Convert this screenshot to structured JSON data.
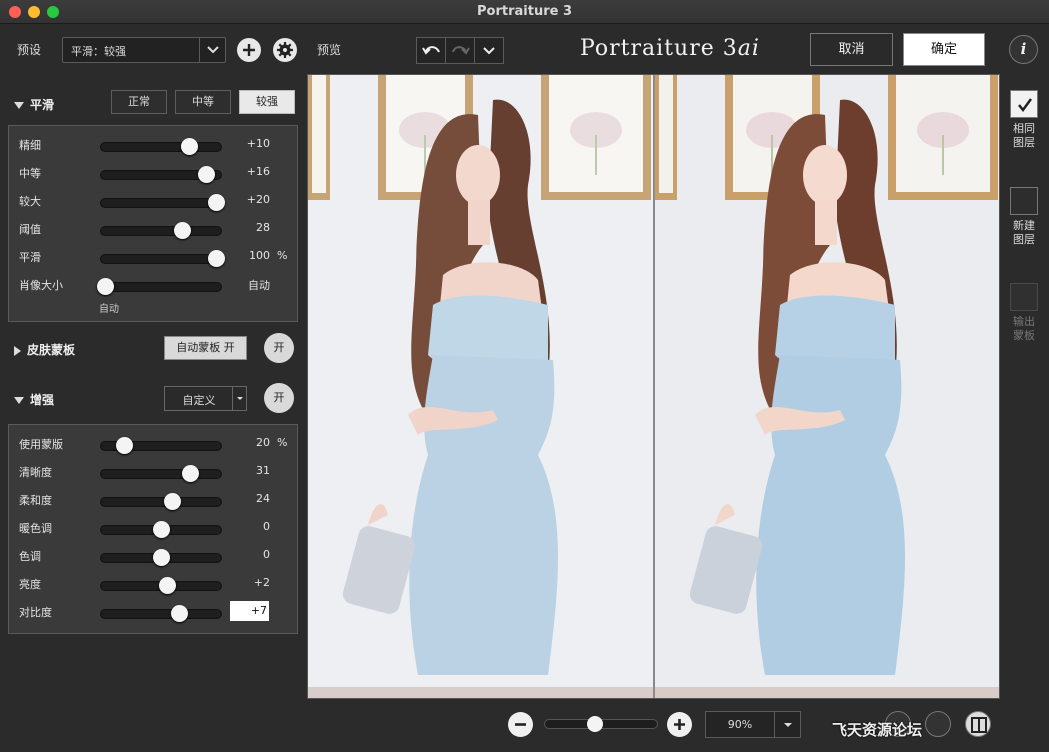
{
  "window": {
    "title": "Portraiture 3"
  },
  "toolbar": {
    "preset_label": "预设",
    "preset_value": "平滑：较强",
    "preview_label": "预览",
    "brand_main": "Portraiture 3",
    "brand_suffix": "ai",
    "cancel": "取消",
    "ok": "确定",
    "info": "i"
  },
  "smoothing": {
    "title": "平滑",
    "modes": [
      {
        "label": "正常",
        "active": false
      },
      {
        "label": "中等",
        "active": false
      },
      {
        "label": "较强",
        "active": true
      }
    ],
    "sliders": [
      {
        "label": "精细",
        "value": "+10",
        "fraction": 0.73
      },
      {
        "label": "中等",
        "value": "+16",
        "fraction": 0.87
      },
      {
        "label": "较大",
        "value": "+20",
        "fraction": 0.95
      },
      {
        "label": "阈值",
        "value": "28",
        "fraction": 0.67
      },
      {
        "label": "平滑",
        "value": "100",
        "unit": "%",
        "fraction": 0.95
      },
      {
        "label": "肖像大小",
        "value": "自动",
        "fraction": 0.04
      }
    ],
    "portrait_auto": "自动"
  },
  "skin_mask": {
    "title": "皮肤蒙板",
    "auto_btn": "自动蒙板 开",
    "toggle": "开"
  },
  "enhance": {
    "title": "增强",
    "preset": "自定义",
    "toggle": "开",
    "sliders": [
      {
        "label": "使用蒙版",
        "value": "20",
        "unit": "%",
        "fraction": 0.2
      },
      {
        "label": "清晰度",
        "value": "31",
        "fraction": 0.74
      },
      {
        "label": "柔和度",
        "value": "24",
        "fraction": 0.59
      },
      {
        "label": "暖色调",
        "value": "0",
        "fraction": 0.5
      },
      {
        "label": "色调",
        "value": "0",
        "fraction": 0.5
      },
      {
        "label": "亮度",
        "value": "+2",
        "fraction": 0.55
      },
      {
        "label": "对比度",
        "value": "+7",
        "fraction": 0.65
      }
    ]
  },
  "side": {
    "same_layer": "相同图层",
    "new_layer": "新建图层",
    "output_mask": "输出蒙板"
  },
  "bottom": {
    "zoom_value": "90%",
    "zoom_fraction": 0.45,
    "watermark": "飞天资源论坛"
  },
  "colors": {
    "background": "#2b2b2b",
    "panel": "#3a3a3a",
    "active_button": "#e9e9e9"
  }
}
